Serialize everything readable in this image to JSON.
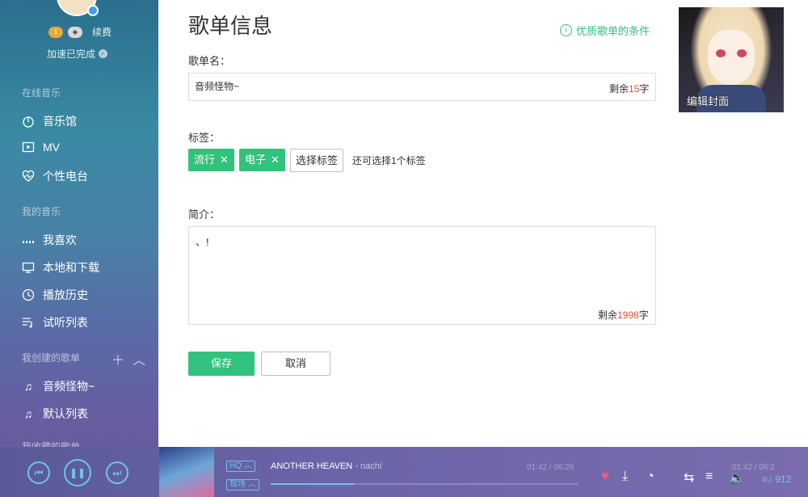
{
  "sidebar": {
    "renew_label": "续费",
    "speed_status": "加速已完成",
    "sections": {
      "online": "在线音乐",
      "mine": "我的音乐",
      "created": "我创建的歌单",
      "collected": "我收藏的歌单"
    },
    "online_items": [
      "音乐馆",
      "MV",
      "个性电台"
    ],
    "mine_items": [
      "我喜欢",
      "本地和下载",
      "播放历史",
      "试听列表"
    ],
    "created_items": [
      "音频怪物~",
      "默认列表"
    ]
  },
  "main": {
    "title": "歌单信息",
    "quality_link": "优质歌单的条件",
    "name_label": "歌单名：",
    "name_value": "音频怪物~",
    "name_remaining_prefix": "剩余",
    "name_remaining": "15",
    "remaining_suffix": "字",
    "tags_label": "标签：",
    "tags": [
      "流行",
      "电子"
    ],
    "choose_tag": "选择标签",
    "tag_hint": "还可选择1个标签",
    "intro_label": "简介：",
    "intro_value": "、!",
    "intro_remaining_prefix": "剩余",
    "intro_remaining": "1998",
    "save": "保存",
    "cancel": "取消",
    "cover_label": "编辑封面"
  },
  "player": {
    "quality_badge": "HQ",
    "mode_badge": "现场",
    "song_title": "ANOTHER HEAVEN",
    "song_artist": " - nachi",
    "time_left": "01:42 / 06:26",
    "time_right": "01:42 / 06:2",
    "progress": 0.27,
    "list_count": "912"
  },
  "colors": {
    "accent_green": "#31c27c",
    "counter_red": "#e64f3c",
    "player_blue": "#6fc4ea"
  }
}
